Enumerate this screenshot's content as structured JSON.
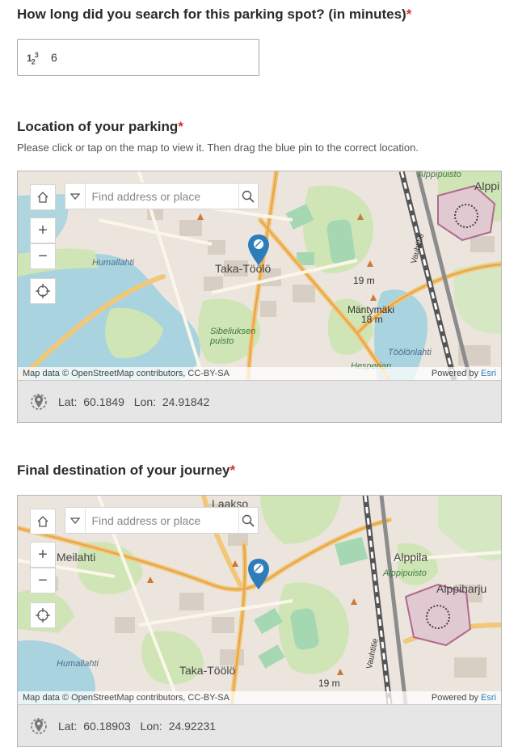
{
  "q_search_time": {
    "label": "How long did you search for this parking spot? (in minutes)",
    "required_mark": "*",
    "value": "6",
    "icon": "number-icon"
  },
  "q_parking_location": {
    "label": "Location of your parking",
    "required_mark": "*",
    "hint": "Please click or tap on the map to view it. Then drag the blue pin to the correct location.",
    "map": {
      "search_placeholder": "Find address or place",
      "attribution": "Map data © OpenStreetMap contributors, CC-BY-SA",
      "powered_by": "Powered by",
      "powered_by_brand": "Esri",
      "labels": {
        "alppipuisto": "Alppipuisto",
        "alppi": "Alppi",
        "humallahti": "Humallahti",
        "taka_toolo": "Taka-Töölö",
        "sibeliuksen_puisto": "Sibeliuksen puisto",
        "vauhtitie": "Vauhtitie",
        "elev_19": "19 m",
        "mantymaki": "Mäntymäki",
        "elev_18": "18 m",
        "toolonlahti": "Töölönlahti",
        "hesperian": "Hesperian",
        "puisto": "puisto"
      }
    },
    "lat_label": "Lat:",
    "lat_value": "60.1849",
    "lon_label": "Lon:",
    "lon_value": "24.91842"
  },
  "q_destination": {
    "label": "Final destination of your journey",
    "required_mark": "*",
    "map": {
      "search_placeholder": "Find address or place",
      "attribution": "Map data © OpenStreetMap contributors, CC-BY-SA",
      "powered_by": "Powered by",
      "powered_by_brand": "Esri",
      "labels": {
        "laakso": "Laakso",
        "meilahti": "Meilahti",
        "alppila": "Alppila",
        "alppipuisto": "Alppipuisto",
        "alppiharju": "Alppiharju",
        "humallahti": "Humallahti",
        "taka_toolo": "Taka-Töölö",
        "vauhtitie": "Vauhtitie",
        "elev_19": "19 m"
      }
    },
    "lat_label": "Lat:",
    "lat_value": "60.18903",
    "lon_label": "Lon:",
    "lon_value": "24.92231"
  },
  "colors": {
    "required": "#d83020",
    "pin": "#2d7dbd",
    "water": "#a9d3df",
    "park": "#cfe5b5"
  }
}
